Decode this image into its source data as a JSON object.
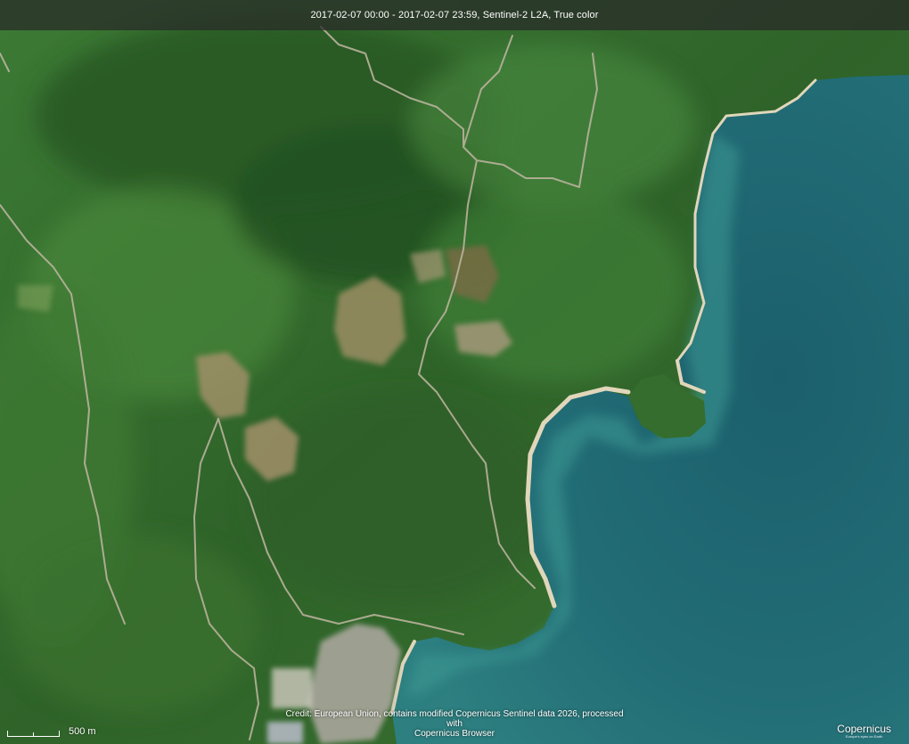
{
  "map": {
    "title": "2017-02-07 00:00 - 2017-02-07 23:59, Sentinel-2 L2A, True color",
    "scale_label": "500 m",
    "credit_line1": "Credit: European Union, contains modified Copernicus Sentinel data 2026, processed with",
    "credit_line2": "Copernicus Browser",
    "logo_text": "Copernicus",
    "logo_subtext": "Europe's eyes on Earth",
    "colors": {
      "forest_dark": "#2c5a27",
      "forest_mid": "#3f7a34",
      "forest_light": "#5a8f45",
      "sea_deep": "#1f6873",
      "sea_shallow": "#3a8c8a",
      "sand": "#d8cdb0",
      "clearing": "#9a8a62",
      "road": "#b8b09a",
      "town": "#a7a49c"
    }
  }
}
